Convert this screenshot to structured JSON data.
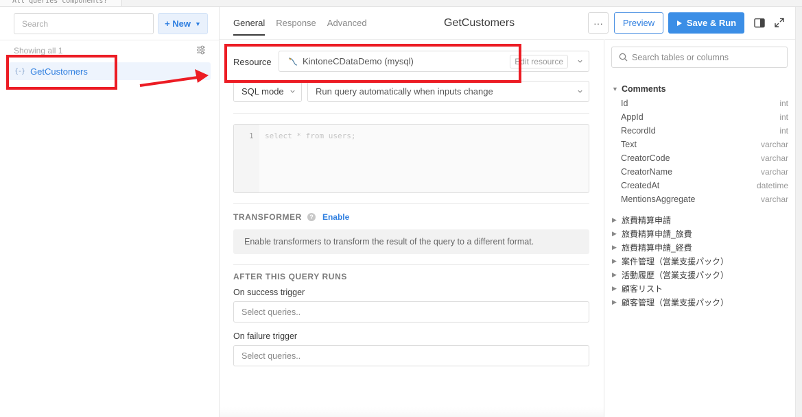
{
  "window": {
    "tab_text": "All queries components?"
  },
  "left": {
    "search_placeholder": "Search",
    "new_button": "+ New",
    "showing_text": "Showing all 1",
    "queries": [
      {
        "icon_text": "{-}",
        "name": "GetCustomers"
      }
    ]
  },
  "editor": {
    "tabs": [
      "General",
      "Response",
      "Advanced"
    ],
    "active_tab": "General",
    "query_name": "GetCustomers",
    "resource_label": "Resource",
    "resource_value": "KintoneCDataDemo (mysql)",
    "edit_resource": "Edit resource",
    "mode": "SQL mode",
    "run_behavior": "Run query automatically when inputs change",
    "code_line_number": "1",
    "code_placeholder": "select * from users;",
    "transformer_title": "TRANSFORMER",
    "transformer_enable": "Enable",
    "transformer_info": "Enable transformers to transform the result of the query to a different format.",
    "after_title": "AFTER THIS QUERY RUNS",
    "success_label": "On success trigger",
    "failure_label": "On failure trigger",
    "select_placeholder": "Select queries.."
  },
  "toolbar": {
    "more_label": "···",
    "preview_label": "Preview",
    "save_run_label": "Save & Run"
  },
  "schema": {
    "search_placeholder": "Search tables or columns",
    "expanded_table": "Comments",
    "columns": [
      {
        "name": "Id",
        "type": "int"
      },
      {
        "name": "AppId",
        "type": "int"
      },
      {
        "name": "RecordId",
        "type": "int"
      },
      {
        "name": "Text",
        "type": "varchar"
      },
      {
        "name": "CreatorCode",
        "type": "varchar"
      },
      {
        "name": "CreatorName",
        "type": "varchar"
      },
      {
        "name": "CreatedAt",
        "type": "datetime"
      },
      {
        "name": "MentionsAggregate",
        "type": "varchar"
      }
    ],
    "tables": [
      "旅費精算申請",
      "旅費精算申請_旅費",
      "旅費精算申請_経費",
      "案件管理（営業支援パック）",
      "活動履歴（営業支援パック）",
      "顧客リスト",
      "顧客管理（営業支援パック）"
    ]
  },
  "colors": {
    "accent": "#2f7fe0",
    "annotation": "#ec1c24",
    "primary_button": "#3b8ee6"
  }
}
